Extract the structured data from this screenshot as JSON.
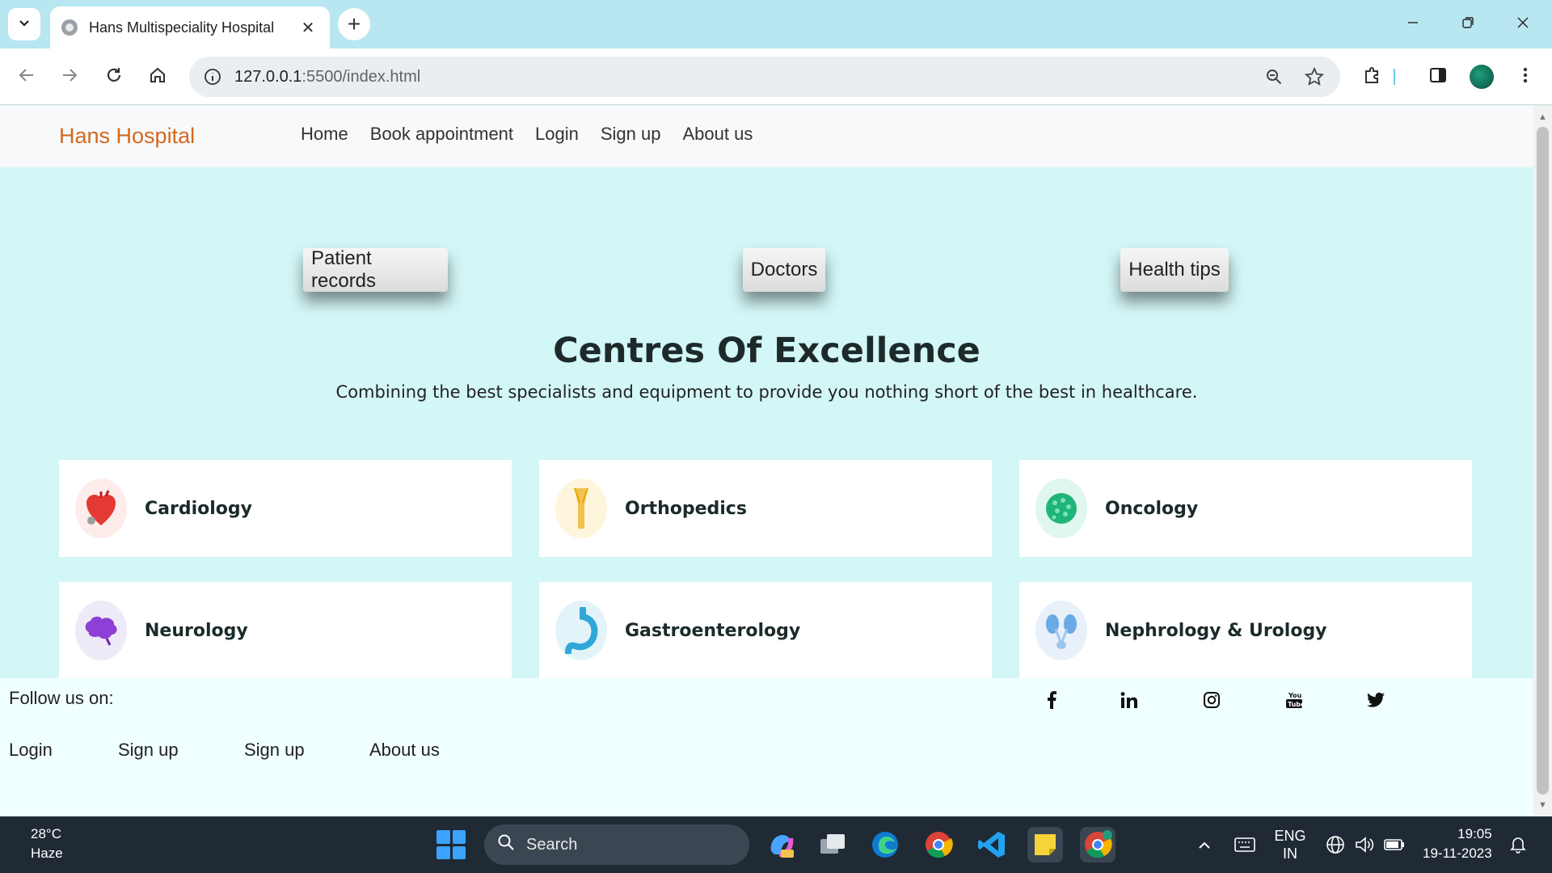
{
  "browser": {
    "tab_title": "Hans Multispeciality Hospital",
    "tab_close": "✕",
    "new_tab": "+",
    "url_host": "127.0.0.1",
    "url_path": ":5500/index.html"
  },
  "site": {
    "brand": "Hans Hospital",
    "nav": [
      "Home",
      "Book appointment",
      "Login",
      "Sign up",
      "About us"
    ],
    "pills": [
      "Patient records",
      "Doctors",
      "Health tips"
    ],
    "heading": "Centres Of Excellence",
    "subheading": "Combining the best specialists and equipment to provide you nothing short of the best in healthcare.",
    "centres": [
      {
        "label": "Cardiology",
        "icon": "heart-icon",
        "color": "#e53935"
      },
      {
        "label": "Orthopedics",
        "icon": "bone-icon",
        "color": "#f2c14e"
      },
      {
        "label": "Oncology",
        "icon": "cell-icon",
        "color": "#1fb57a"
      },
      {
        "label": "Neurology",
        "icon": "brain-icon",
        "color": "#8e3fd6"
      },
      {
        "label": "Gastroenterology",
        "icon": "stomach-icon",
        "color": "#2fa8d8"
      },
      {
        "label": "Nephrology & Urology",
        "icon": "kidney-icon",
        "color": "#6aa9e6"
      }
    ]
  },
  "footer": {
    "follow": "Follow us on:",
    "social": [
      "facebook-icon",
      "linkedin-icon",
      "instagram-icon",
      "youtube-icon",
      "twitter-icon"
    ],
    "links": [
      "Login",
      "Sign up",
      "Sign up",
      "About us"
    ]
  },
  "taskbar": {
    "temp": "28°C",
    "weather": "Haze",
    "search": "Search",
    "lang1": "ENG",
    "lang2": "IN",
    "time": "19:05",
    "date": "19-11-2023"
  },
  "colors": {
    "page_bg": "#d3f6f6",
    "brand": "#d2691e",
    "footer_bg": "#f0ffff",
    "tabbar_bg": "#b8e7f1"
  }
}
